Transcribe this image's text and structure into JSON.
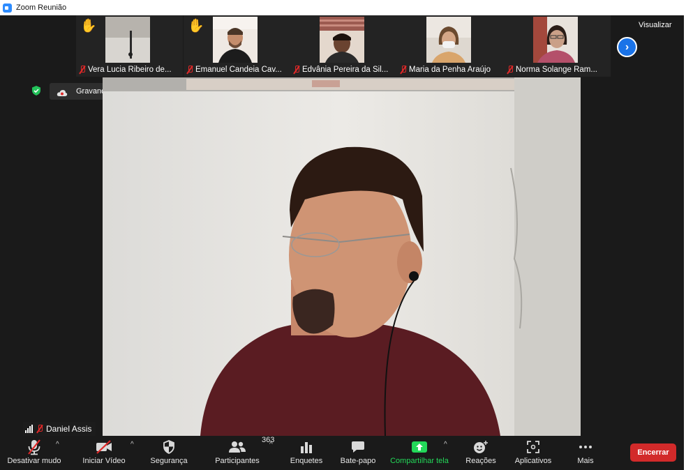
{
  "window": {
    "title": "Zoom Reunião"
  },
  "thumbnails": [
    {
      "name": "Vera Lucia Ribeiro de...",
      "hand_raised": true
    },
    {
      "name": "Emanuel Candeia Cav...",
      "hand_raised": true
    },
    {
      "name": "Edvânia Pereira da Sil...",
      "hand_raised": false
    },
    {
      "name": "Maria da Penha Araújo",
      "hand_raised": false
    },
    {
      "name": "Norma Solange Ram...",
      "hand_raised": false
    }
  ],
  "view": {
    "label": "Visualizar"
  },
  "recording": {
    "label": "Gravando..."
  },
  "speaker": {
    "name": "Daniel Assis"
  },
  "toolbar": {
    "mute": "Desativar mudo",
    "video": "Iniciar Vídeo",
    "security": "Segurança",
    "participants": "Participantes",
    "participants_count": "363",
    "polls": "Enquetes",
    "chat": "Bate-papo",
    "share": "Compartilhar tela",
    "reactions": "Reações",
    "apps": "Aplicativos",
    "more": "Mais",
    "end": "Encerrar"
  },
  "colors": {
    "accent_blue": "#2d8cff",
    "share_green": "#23d959",
    "end_red": "#d22a2a",
    "muted_red": "#e02828"
  }
}
